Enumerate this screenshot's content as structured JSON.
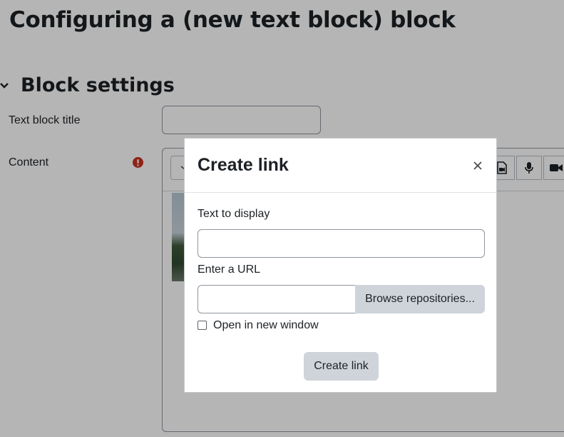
{
  "page": {
    "title": "Configuring a (new text block) block"
  },
  "section": {
    "title": "Block settings",
    "toggle_icon": "chevron-down-icon"
  },
  "form": {
    "title_label": "Text block title",
    "title_value": "",
    "content_label": "Content",
    "required_icon": "exclamation-circle-icon",
    "required_color": "#ca3120"
  },
  "editor": {
    "toolbar_icons": [
      "format-icon",
      "video-file-icon",
      "microphone-icon",
      "video-camera-icon"
    ]
  },
  "modal": {
    "title": "Create link",
    "close_icon": "close-icon",
    "text_label": "Text to display",
    "text_value": "",
    "url_label": "Enter a URL",
    "url_value": "",
    "browse_label": "Browse repositories...",
    "new_window_label": "Open in new window",
    "new_window_checked": false,
    "submit_label": "Create link"
  },
  "colors": {
    "backdrop": "rgba(0,0,0,0.29)",
    "secondary_button": "#ced4da",
    "text": "#1d2125"
  }
}
